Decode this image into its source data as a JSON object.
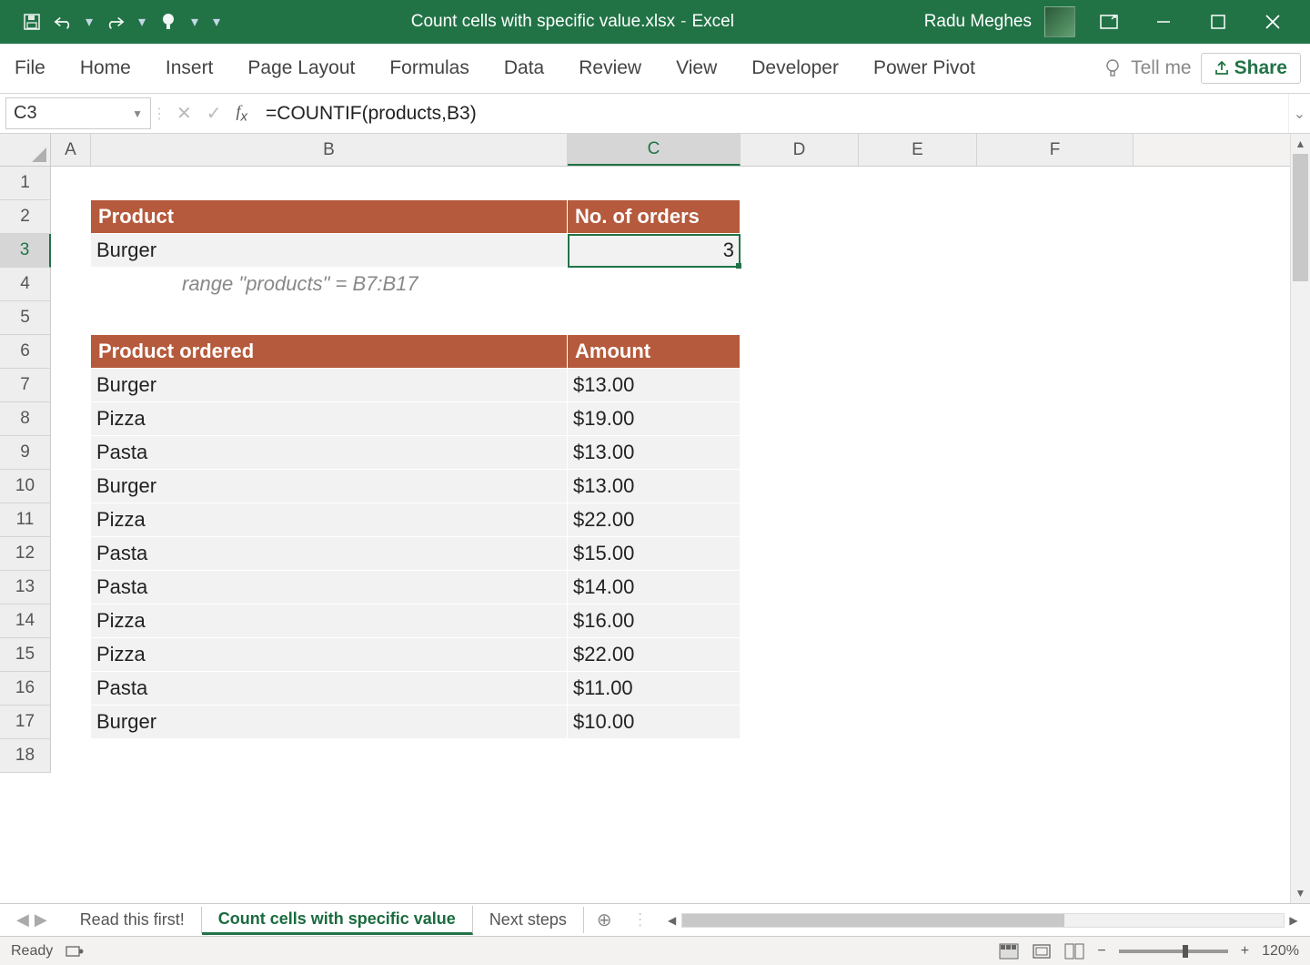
{
  "titlebar": {
    "filename": "Count cells with specific value.xlsx",
    "app": "Excel",
    "separator": "-",
    "user": "Radu Meghes"
  },
  "ribbon": {
    "tabs": [
      "File",
      "Home",
      "Insert",
      "Page Layout",
      "Formulas",
      "Data",
      "Review",
      "View",
      "Developer",
      "Power Pivot"
    ],
    "tell_me": "Tell me",
    "share": "Share"
  },
  "formula_bar": {
    "namebox": "C3",
    "formula": "=COUNTIF(products,B3)"
  },
  "columns": [
    "A",
    "B",
    "C",
    "D",
    "E",
    "F"
  ],
  "rows": [
    "1",
    "2",
    "3",
    "4",
    "5",
    "6",
    "7",
    "8",
    "9",
    "10",
    "11",
    "12",
    "13",
    "14",
    "15",
    "16",
    "17",
    "18"
  ],
  "sheet": {
    "header1": {
      "product": "Product",
      "orders": "No. of orders"
    },
    "summary": {
      "product": "Burger",
      "orders": "3"
    },
    "note": "range \"products\" = B7:B17",
    "header2": {
      "product": "Product ordered",
      "amount": "Amount"
    },
    "orders": [
      {
        "product": "Burger",
        "currency": "$",
        "amount": "13.00"
      },
      {
        "product": "Pizza",
        "currency": "$",
        "amount": "19.00"
      },
      {
        "product": "Pasta",
        "currency": "$",
        "amount": "13.00"
      },
      {
        "product": "Burger",
        "currency": "$",
        "amount": "13.00"
      },
      {
        "product": "Pizza",
        "currency": "$",
        "amount": "22.00"
      },
      {
        "product": "Pasta",
        "currency": "$",
        "amount": "15.00"
      },
      {
        "product": "Pasta",
        "currency": "$",
        "amount": "14.00"
      },
      {
        "product": "Pizza",
        "currency": "$",
        "amount": "16.00"
      },
      {
        "product": "Pizza",
        "currency": "$",
        "amount": "22.00"
      },
      {
        "product": "Pasta",
        "currency": "$",
        "amount": "11.00"
      },
      {
        "product": "Burger",
        "currency": "$",
        "amount": "10.00"
      }
    ]
  },
  "sheet_tabs": {
    "tabs": [
      "Read this first!",
      "Count cells with specific value",
      "Next steps"
    ],
    "active_index": 1
  },
  "statusbar": {
    "ready": "Ready",
    "zoom": "120%"
  }
}
